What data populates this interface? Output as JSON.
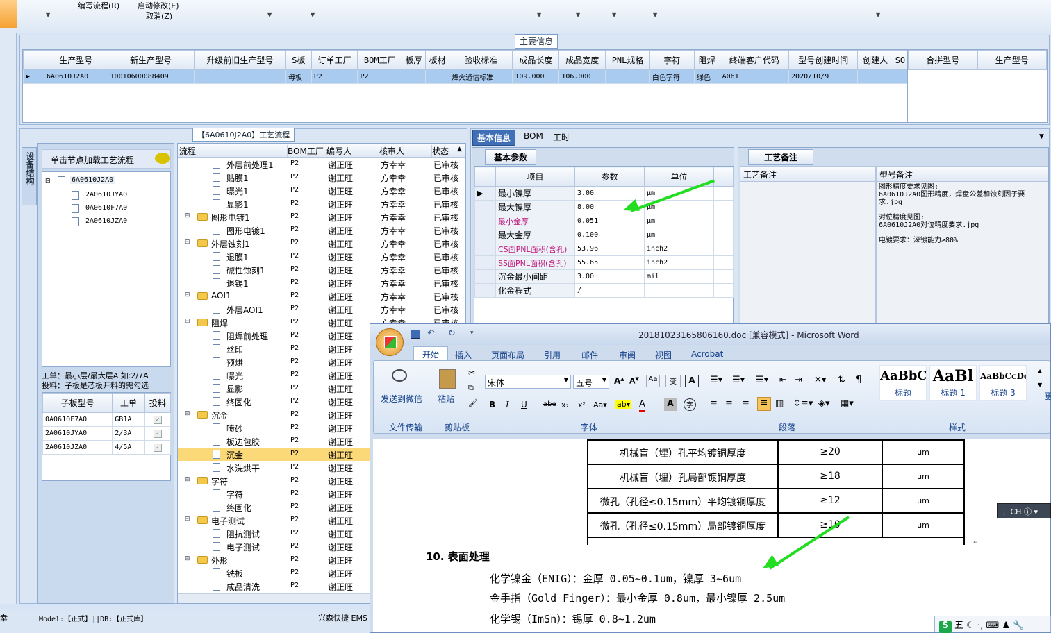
{
  "menu": {
    "edit_flow": "编写流程(R)",
    "start_modify": "启动修改(E)",
    "cancel": "取消(Z)"
  },
  "main_info": {
    "title": "主要信息",
    "columns": [
      "生产型号",
      "新生产型号",
      "升级前旧生产型号",
      "S板",
      "订单工厂",
      "BOM工厂",
      "板厚",
      "板材",
      "验收标准",
      "成品长度",
      "成品宽度",
      "PNL规格",
      "字符",
      "阻焊",
      "终端客户代码",
      "型号创建时间",
      "创建人",
      "SO"
    ],
    "row": [
      "6A0610J2A0",
      "10010600088409",
      "",
      "母板",
      "P2",
      "P2",
      "",
      "",
      "烽火通信标准",
      "109.000",
      "106.000",
      "",
      "白色字符",
      "绿色",
      "A061",
      "2020/10/9",
      "",
      ""
    ],
    "side_columns": [
      "合拼型号",
      "生产型号"
    ]
  },
  "process_panel": {
    "title": "【6A0610J2A0】工艺流程",
    "left_tab": "设备结构",
    "hint": "单击节点加载工艺流程",
    "tree": {
      "root": "6A0610J2A0",
      "children": [
        "2A0610JYA0",
        "0A0610F7A0",
        "2A0610JZA0"
      ]
    },
    "note_line1": "工单：最小层/最大层A 如:2/7A",
    "note_line2": "投料：子板是芯板开料的需勾选",
    "sub_columns": [
      "子板型号",
      "工单",
      "投料"
    ],
    "sub_rows": [
      [
        "0A0610F7A0",
        "GB1A"
      ],
      [
        "2A0610JYA0",
        "2/3A"
      ],
      [
        "2A0610JZA0",
        "4/5A"
      ]
    ],
    "flow_columns": [
      "流程",
      "BOM工厂",
      "编写人",
      "核审人",
      "状态"
    ],
    "flow_rows": [
      {
        "name": "外层前处理1",
        "type": "doc",
        "indent": 2,
        "bom": "P2",
        "writer": "谢正旺",
        "checker": "方幸幸",
        "status": "已审核"
      },
      {
        "name": "贴膜1",
        "type": "doc",
        "indent": 2,
        "bom": "P2",
        "writer": "谢正旺",
        "checker": "方幸幸",
        "status": "已审核"
      },
      {
        "name": "曝光1",
        "type": "doc",
        "indent": 2,
        "bom": "P2",
        "writer": "谢正旺",
        "checker": "方幸幸",
        "status": "已审核"
      },
      {
        "name": "显影1",
        "type": "doc",
        "indent": 2,
        "bom": "P2",
        "writer": "谢正旺",
        "checker": "方幸幸",
        "status": "已审核"
      },
      {
        "name": "图形电镀1",
        "type": "folder",
        "indent": 1,
        "bom": "P2",
        "writer": "谢正旺",
        "checker": "方幸幸",
        "status": "已审核"
      },
      {
        "name": "图形电镀1",
        "type": "doc",
        "indent": 2,
        "bom": "P2",
        "writer": "谢正旺",
        "checker": "方幸幸",
        "status": "已审核"
      },
      {
        "name": "外层蚀刻1",
        "type": "folder",
        "indent": 1,
        "bom": "P2",
        "writer": "谢正旺",
        "checker": "方幸幸",
        "status": "已审核"
      },
      {
        "name": "退膜1",
        "type": "doc",
        "indent": 2,
        "bom": "P2",
        "writer": "谢正旺",
        "checker": "方幸幸",
        "status": "已审核"
      },
      {
        "name": "碱性蚀刻1",
        "type": "doc",
        "indent": 2,
        "bom": "P2",
        "writer": "谢正旺",
        "checker": "方幸幸",
        "status": "已审核"
      },
      {
        "name": "退锡1",
        "type": "doc",
        "indent": 2,
        "bom": "P2",
        "writer": "谢正旺",
        "checker": "方幸幸",
        "status": "已审核"
      },
      {
        "name": "AOI1",
        "type": "folder",
        "indent": 1,
        "bom": "P2",
        "writer": "谢正旺",
        "checker": "方幸幸",
        "status": "已审核"
      },
      {
        "name": "外层AOI1",
        "type": "doc",
        "indent": 2,
        "bom": "P2",
        "writer": "谢正旺",
        "checker": "方幸幸",
        "status": "已审核"
      },
      {
        "name": "阻焊",
        "type": "folder",
        "indent": 1,
        "bom": "P2",
        "writer": "谢正旺",
        "checker": "方幸幸",
        "status": "已审核"
      },
      {
        "name": "阻焊前处理",
        "type": "doc",
        "indent": 2,
        "bom": "P2",
        "writer": "谢正旺",
        "checker": "",
        "status": ""
      },
      {
        "name": "丝印",
        "type": "doc",
        "indent": 2,
        "bom": "P2",
        "writer": "谢正旺",
        "checker": "",
        "status": ""
      },
      {
        "name": "预烘",
        "type": "doc",
        "indent": 2,
        "bom": "P2",
        "writer": "谢正旺",
        "checker": "",
        "status": ""
      },
      {
        "name": "曝光",
        "type": "doc",
        "indent": 2,
        "bom": "P2",
        "writer": "谢正旺",
        "checker": "",
        "status": ""
      },
      {
        "name": "显影",
        "type": "doc",
        "indent": 2,
        "bom": "P2",
        "writer": "谢正旺",
        "checker": "",
        "status": ""
      },
      {
        "name": "终固化",
        "type": "doc",
        "indent": 2,
        "bom": "P2",
        "writer": "谢正旺",
        "checker": "",
        "status": ""
      },
      {
        "name": "沉金",
        "type": "folder",
        "indent": 1,
        "bom": "P2",
        "writer": "谢正旺",
        "checker": "",
        "status": ""
      },
      {
        "name": "喷砂",
        "type": "doc",
        "indent": 2,
        "bom": "P2",
        "writer": "谢正旺",
        "checker": "",
        "status": ""
      },
      {
        "name": "板边包胶",
        "type": "doc",
        "indent": 2,
        "bom": "P2",
        "writer": "谢正旺",
        "checker": "",
        "status": ""
      },
      {
        "name": "沉金",
        "type": "doc",
        "indent": 2,
        "bom": "P2",
        "writer": "谢正旺",
        "checker": "",
        "status": "",
        "selected": true
      },
      {
        "name": "水洗烘干",
        "type": "doc",
        "indent": 2,
        "bom": "P2",
        "writer": "谢正旺",
        "checker": "",
        "status": ""
      },
      {
        "name": "字符",
        "type": "folder",
        "indent": 1,
        "bom": "P2",
        "writer": "谢正旺",
        "checker": "",
        "status": ""
      },
      {
        "name": "字符",
        "type": "doc",
        "indent": 2,
        "bom": "P2",
        "writer": "谢正旺",
        "checker": "",
        "status": ""
      },
      {
        "name": "终固化",
        "type": "doc",
        "indent": 2,
        "bom": "P2",
        "writer": "谢正旺",
        "checker": "",
        "status": ""
      },
      {
        "name": "电子测试",
        "type": "folder",
        "indent": 1,
        "bom": "P2",
        "writer": "谢正旺",
        "checker": "",
        "status": ""
      },
      {
        "name": "阻抗测试",
        "type": "doc",
        "indent": 2,
        "bom": "P2",
        "writer": "谢正旺",
        "checker": "",
        "status": ""
      },
      {
        "name": "电子测试",
        "type": "doc",
        "indent": 2,
        "bom": "P2",
        "writer": "谢正旺",
        "checker": "",
        "status": ""
      },
      {
        "name": "外形",
        "type": "folder",
        "indent": 1,
        "bom": "P2",
        "writer": "谢正旺",
        "checker": "",
        "status": ""
      },
      {
        "name": "铣板",
        "type": "doc",
        "indent": 2,
        "bom": "P2",
        "writer": "谢正旺",
        "checker": "",
        "status": ""
      },
      {
        "name": "成品清洗",
        "type": "doc",
        "indent": 2,
        "bom": "P2",
        "writer": "谢正旺",
        "checker": "",
        "status": ""
      }
    ]
  },
  "info_panel": {
    "tabs": [
      "基本信息",
      "BOM",
      "工时"
    ],
    "basic_tab": "基本参数",
    "columns": [
      "项目",
      "参数",
      "单位"
    ],
    "params": [
      {
        "item": "最小镍厚",
        "value": "3.00",
        "unit": "μm",
        "pink": false
      },
      {
        "item": "最大镍厚",
        "value": "8.00",
        "unit": "μm",
        "pink": false
      },
      {
        "item": "最小金厚",
        "value": "0.051",
        "unit": "μm",
        "pink": true
      },
      {
        "item": "最大金厚",
        "value": "0.100",
        "unit": "μm",
        "pink": false
      },
      {
        "item": "CS面PNL面积(含孔)",
        "value": "53.96",
        "unit": "inch2",
        "pink": true
      },
      {
        "item": "SS面PNL面积(含孔)",
        "value": "55.65",
        "unit": "inch2",
        "pink": true
      },
      {
        "item": "沉金最小间距",
        "value": "3.00",
        "unit": "mil",
        "pink": false
      },
      {
        "item": "化金程式",
        "value": "/",
        "unit": "",
        "pink": false
      }
    ],
    "remark_tab": "工艺备注",
    "remark_columns": [
      "工艺备注",
      "型号备注"
    ],
    "model_remark": [
      "图形精度要求见图:",
      "6A0610J2A0图形精度，焊盘公差和蚀刻因子要求.jpg",
      "",
      "对位精度见图:",
      "6A0610J2A0对位精度要求.jpg",
      "",
      "电镀要求：深镀能力≥80%"
    ]
  },
  "status_bar": {
    "left": "Model:【正式】||DB:【正式库】",
    "right": "兴森快捷  EMS",
    "edge": "幸"
  },
  "word": {
    "title": "20181023165806160.doc [兼容模式] - Microsoft Word",
    "tabs": [
      "开始",
      "插入",
      "页面布局",
      "引用",
      "邮件",
      "审阅",
      "视图",
      "Acrobat"
    ],
    "groups": {
      "wechat": "文件传输",
      "clipboard": "剪贴板",
      "font": "字体",
      "paragraph": "段落",
      "styles": "样式"
    },
    "wechat_label": "发送到微信",
    "paste_label": "粘贴",
    "font_name": "宋体",
    "font_size": "五号",
    "styles": [
      {
        "preview": "AaBbC(",
        "name": "标题"
      },
      {
        "preview": "AaBl",
        "name": "标题 1"
      },
      {
        "preview": "AaBbCcDc",
        "name": "标题 3"
      }
    ],
    "more": "更",
    "table_rows": [
      [
        "机械盲（埋）孔平均镀铜厚度",
        "≥20",
        "um"
      ],
      [
        "机械盲（埋）孔局部镀铜厚度",
        "≥18",
        "um"
      ],
      [
        "微孔（孔径≤0.15mm）平均镀铜厚度",
        "≥12",
        "um"
      ],
      [
        "微孔（孔径≤0.15mm）局部镀铜厚度",
        "≥10",
        "um"
      ]
    ],
    "heading": "10. 表面处理",
    "lines": [
      "化学镍金（ENIG）：金厚 0.05~0.1um，镍厚 3~6um",
      "金手指（Gold Finger）：最小金厚 0.8um，最小镍厚 2.5um",
      "化学锡（ImSn）：锡厚 0.8~1.2um"
    ],
    "ime": "CH",
    "ime_bar": "五"
  }
}
